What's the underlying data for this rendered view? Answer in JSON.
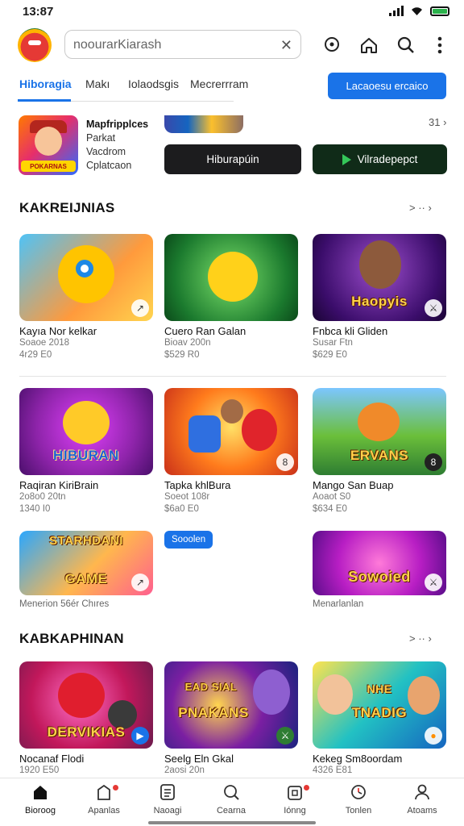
{
  "status": {
    "time": "13:87"
  },
  "search": {
    "placeholder": "noourarKiarash",
    "clear_icon": "clear-x-icon"
  },
  "header_icons": [
    "location-pin-icon",
    "home-icon",
    "search-icon",
    "more-vertical-icon"
  ],
  "tabs": [
    {
      "label": "Hiboragia",
      "active": true
    },
    {
      "label": "Makı",
      "active": false
    },
    {
      "label": "Iolaodsgis",
      "active": false
    },
    {
      "label": "Mecrerrram",
      "active": false
    }
  ],
  "primary_button": "Lacaoesu ercaico",
  "featured": {
    "thumb_logo": "POKARNAS",
    "lines": [
      "Mapfripplces",
      "Parkat",
      "Vacdrom",
      "Cplatcaon"
    ],
    "more": "31 ›",
    "button_a": "Hiburapúin",
    "button_b": "Vilradepepct"
  },
  "section1": {
    "title": "KAKREIJNIAS",
    "more": "> ·· ›",
    "cards": [
      {
        "name": "Kayıa Nor kelkar",
        "sub1": "Soaoe 2018",
        "sub2": "4r29 E0",
        "art": "",
        "badge": "↗"
      },
      {
        "name": "Cuero Ran Galan",
        "sub1": "Bioav 200n",
        "sub2": "$529 R0",
        "art": "",
        "badge": ""
      },
      {
        "name": "Fnbca kli Gliden",
        "sub1": "Susar Ftn",
        "sub2": "$629 E0",
        "art": "Haopyis",
        "badge": "⚔"
      },
      {
        "name": "Raqiran KiriBrain",
        "sub1": "2o8o0 20tn",
        "sub2": "1340 I0",
        "art": "HIBURAN",
        "badge": ""
      },
      {
        "name": "Tapka khlBura",
        "sub1": "Soeot 108r",
        "sub2": "$6a0 E0",
        "art": "",
        "badge": "8"
      },
      {
        "name": "Mango San Buap",
        "sub1": "Aoaot S0",
        "sub2": "$634 E0",
        "art": "ERVANS",
        "badge": "8"
      },
      {
        "name": "Menerion 56ér Chıres",
        "sub1": "",
        "sub2": "",
        "art": "GAME",
        "art_top": "STARHDANI",
        "badge": "↗"
      },
      {
        "name": "Menarlanlan",
        "sub1": "",
        "sub2": "",
        "art": "Sowoied",
        "badge": "⚔"
      }
    ],
    "pill": "Sooolen"
  },
  "section2": {
    "title": "KABKAPHINAN",
    "more": "> ·· ›",
    "cards": [
      {
        "name": "Nocanaf Flodi",
        "sub1": "1920 E50",
        "art": "DERVIKIAS",
        "badge": "▶"
      },
      {
        "name": "Seelg Eln Gkal",
        "sub1": "2aosi 20n",
        "art": "PNAKANS",
        "art_top": "EAD SIAL",
        "badge": "⚔"
      },
      {
        "name": "Kekeg Sm8oordam",
        "sub1": "4326 E81",
        "art": "TNADIG",
        "art_top": "NHE",
        "badge": "●"
      }
    ]
  },
  "bottom_nav": [
    {
      "label": "Bioroog",
      "icon": "home-icon",
      "dot": false,
      "active": true
    },
    {
      "label": "Apanlas",
      "icon": "apps-icon",
      "dot": true,
      "active": false
    },
    {
      "label": "Naoagi",
      "icon": "list-icon",
      "dot": false,
      "active": false
    },
    {
      "label": "Cearna",
      "icon": "search-icon",
      "dot": false,
      "active": false
    },
    {
      "label": "Iónng",
      "icon": "gift-icon",
      "dot": true,
      "active": false
    },
    {
      "label": "Tonlen",
      "icon": "clock-icon",
      "dot": false,
      "active": false
    },
    {
      "label": "Atoams",
      "icon": "profile-icon",
      "dot": false,
      "active": false
    }
  ],
  "colors": {
    "accent": "#1a73e8",
    "dark_button": "#1c1c1e",
    "dark_green_button": "#102b18",
    "notification_dot": "#e53935"
  }
}
